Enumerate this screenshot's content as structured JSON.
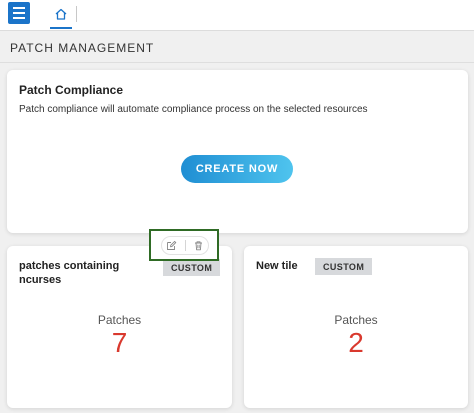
{
  "header": {
    "section_title": "PATCH MANAGEMENT"
  },
  "compliance_card": {
    "title": "Patch Compliance",
    "description": "Patch compliance will automate compliance process on the selected resources",
    "create_label": "CREATE NOW"
  },
  "tiles": [
    {
      "title_line1": "patches containing",
      "title_line2": "ncurses",
      "badge": "CUSTOM",
      "label": "Patches",
      "count": "7"
    },
    {
      "title_line1": "New tile",
      "badge": "CUSTOM",
      "label": "Patches",
      "count": "2"
    }
  ],
  "icons": {
    "menu": "hamburger-menu-icon",
    "home": "home-icon",
    "edit": "edit-icon",
    "delete": "trash-icon"
  },
  "colors": {
    "accent": "#1b74c9",
    "count": "#d9392e",
    "highlight_border": "#2f6b25",
    "badge_bg": "#d7d9dc"
  }
}
